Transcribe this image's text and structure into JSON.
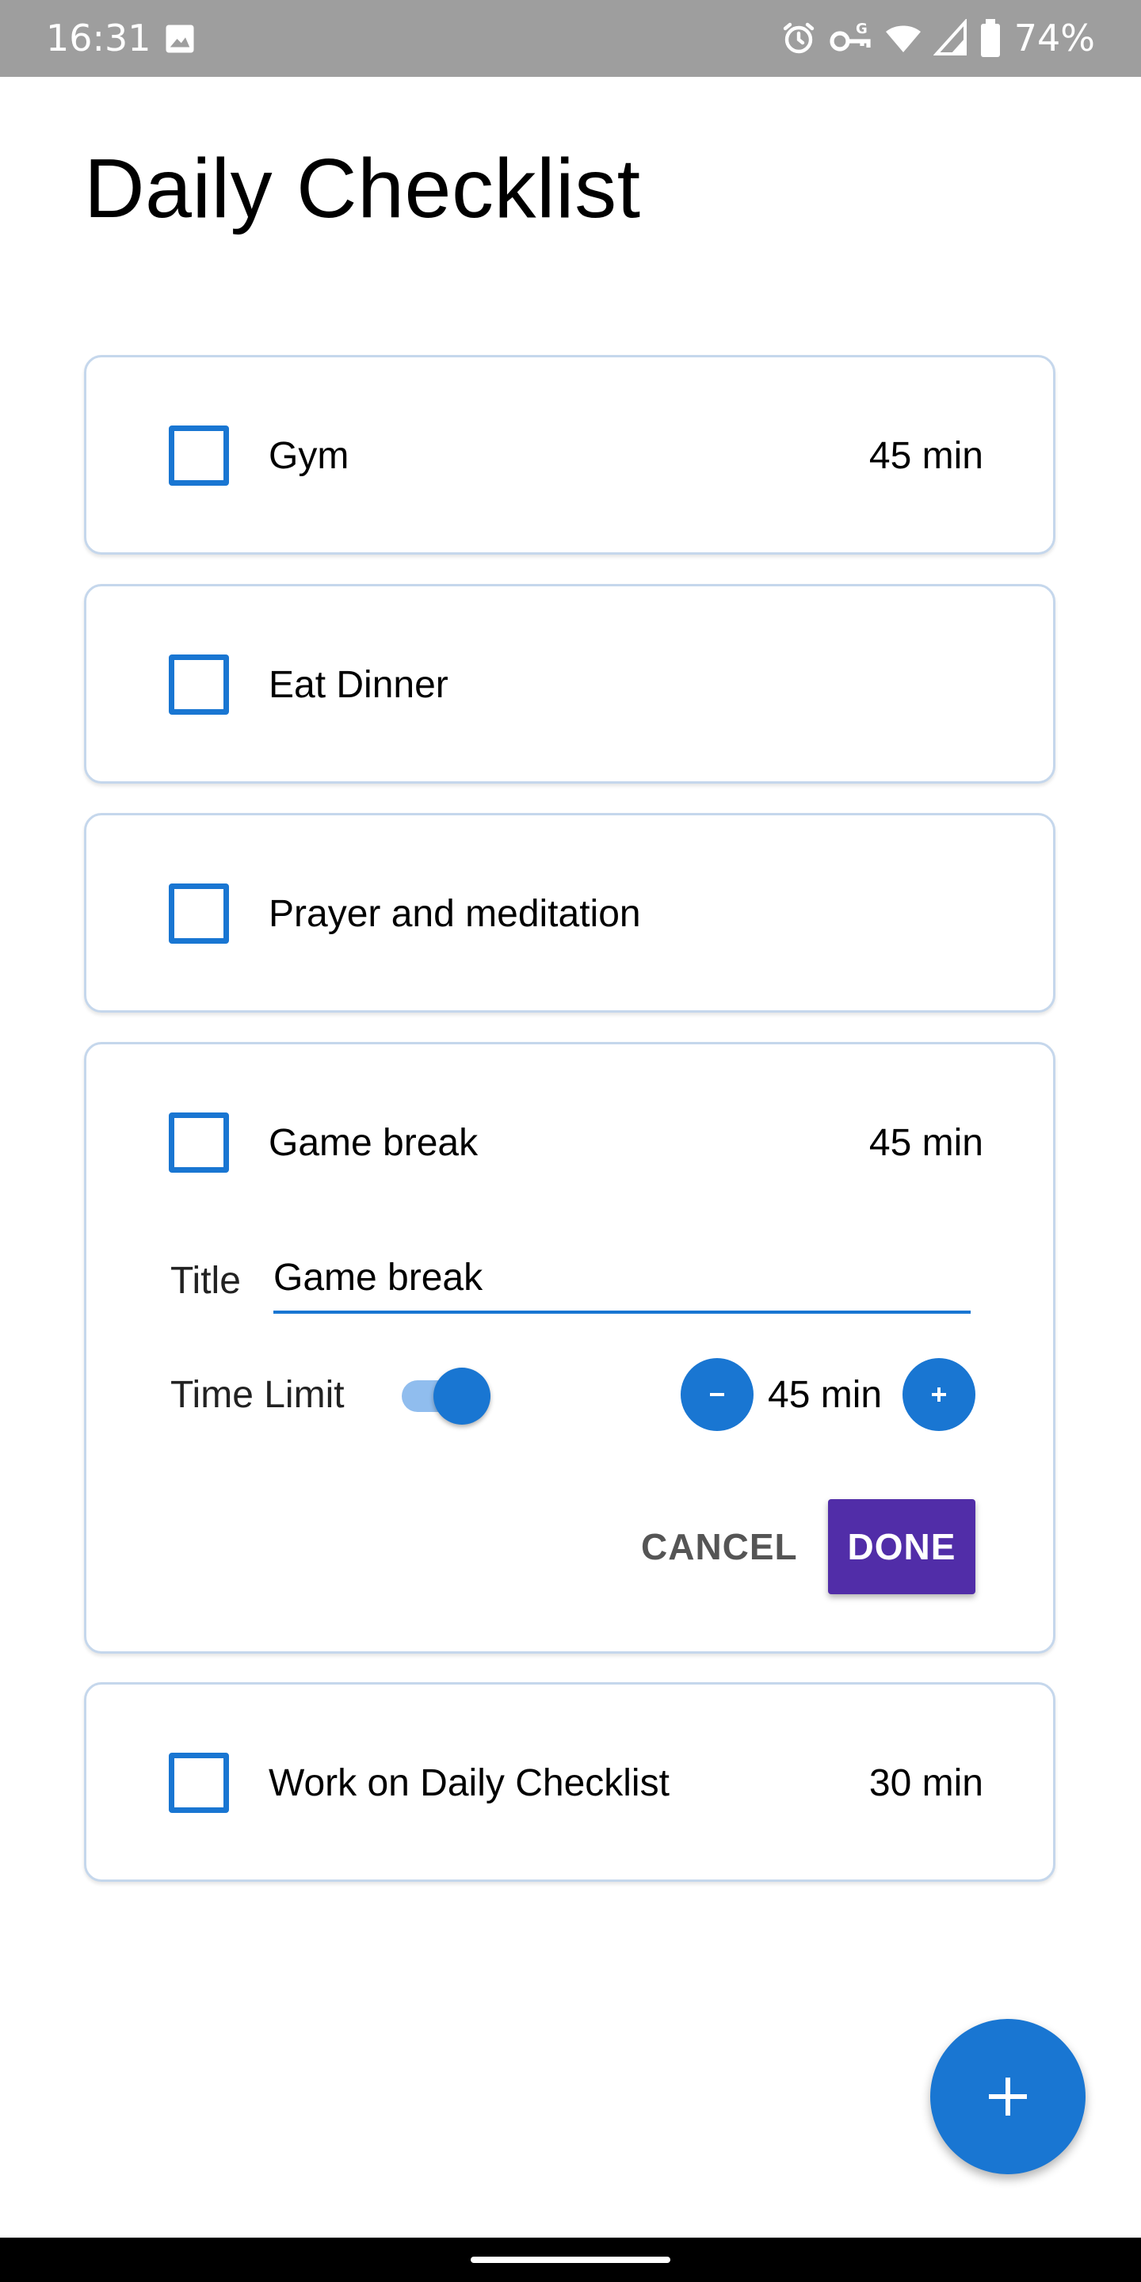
{
  "status_bar": {
    "time": "16:31",
    "battery": "74%",
    "icons": [
      "gallery-icon",
      "alarm-icon",
      "vpn-key-icon",
      "wifi-icon",
      "signal-icon",
      "battery-icon"
    ]
  },
  "page": {
    "title": "Daily Checklist"
  },
  "items": [
    {
      "title": "Gym",
      "time": "45 min",
      "checked": false
    },
    {
      "title": "Eat Dinner",
      "time": "",
      "checked": false
    },
    {
      "title": "Prayer and meditation",
      "time": "",
      "checked": false
    },
    {
      "title": "Game break",
      "time": "45 min",
      "checked": false,
      "expanded": true
    },
    {
      "title": "Work on Daily Checklist",
      "time": "30 min",
      "checked": false
    }
  ],
  "editor": {
    "title_label": "Title",
    "title_value": "Game break",
    "time_limit_label": "Time Limit",
    "time_limit_enabled": true,
    "time_limit_value": "45 min",
    "cancel_label": "CANCEL",
    "done_label": "DONE"
  },
  "colors": {
    "accent": "#1976d2",
    "done_button": "#512da8",
    "status_bar": "#9e9e9e",
    "card_border": "#c5d7ec"
  }
}
